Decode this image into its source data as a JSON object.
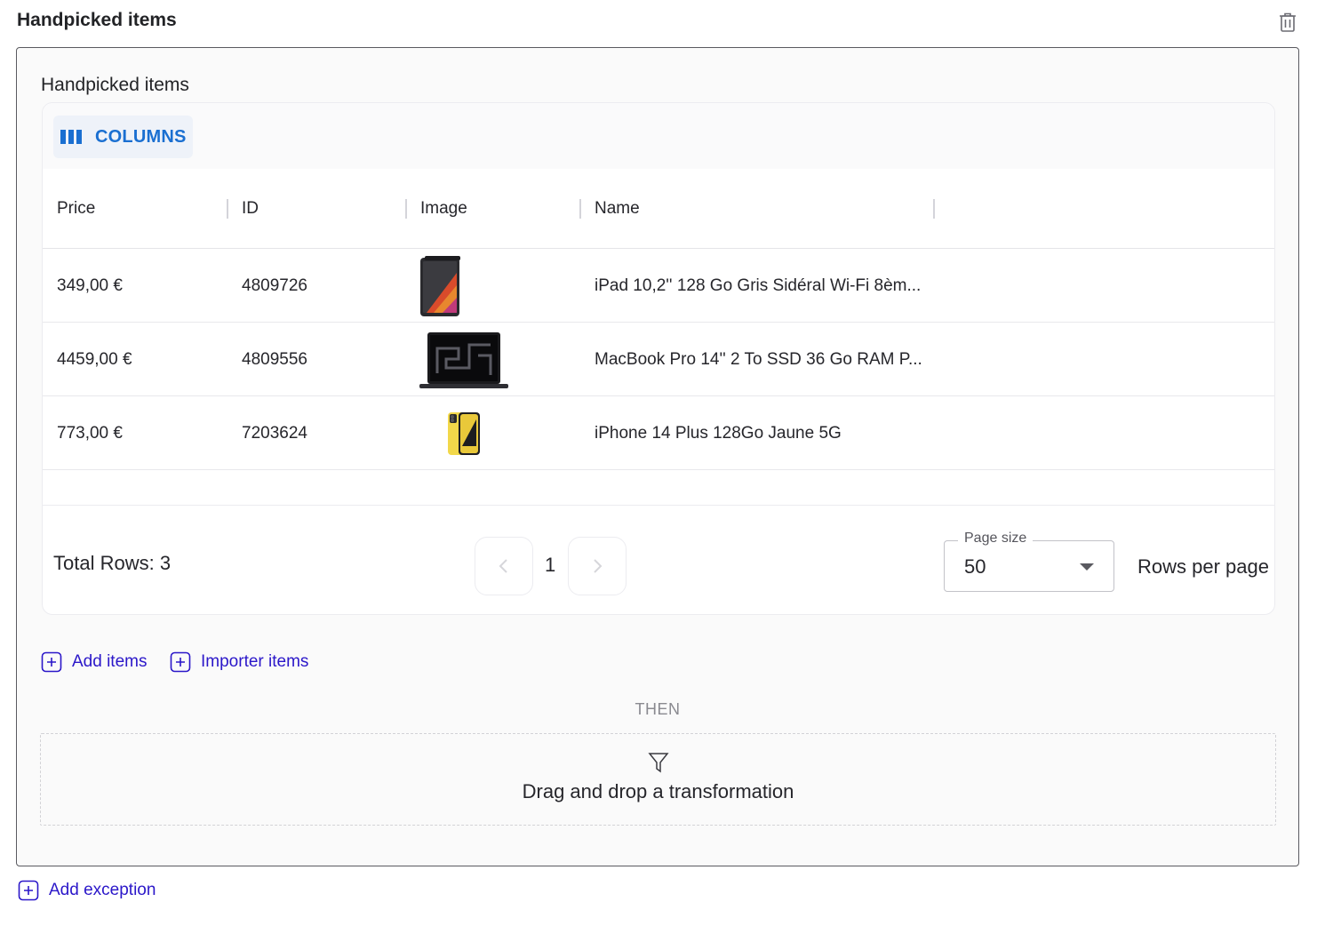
{
  "header": {
    "title": "Handpicked items",
    "delete_icon": "trash-icon"
  },
  "panel": {
    "title": "Handpicked items"
  },
  "toolbar": {
    "columns_label": "COLUMNS",
    "columns_icon": "columns-icon",
    "accent_color": "#1a6fd1"
  },
  "table": {
    "headers": [
      "Price",
      "ID",
      "Image",
      "Name"
    ],
    "rows": [
      {
        "price": "349,00 €",
        "id": "4809726",
        "image": "ipad-thumbnail",
        "name": "iPad 10,2'' 128 Go Gris Sidéral Wi-Fi 8èm..."
      },
      {
        "price": "4459,00 €",
        "id": "4809556",
        "image": "macbook-thumbnail",
        "name": "MacBook Pro 14'' 2 To SSD 36 Go RAM P..."
      },
      {
        "price": "773,00 €",
        "id": "7203624",
        "image": "iphone-thumbnail",
        "name": "iPhone 14 Plus 128Go Jaune 5G"
      }
    ]
  },
  "footer": {
    "total_rows": "Total Rows: 3",
    "current_page": "1",
    "page_size_label": "Page size",
    "page_size_value": "50",
    "rows_per_page": "Rows per page"
  },
  "actions": {
    "add_items": "Add items",
    "import_items": "Importer items",
    "link_color": "#2b17c9"
  },
  "then_label": "THEN",
  "dropzone": {
    "icon": "filter-icon",
    "text": "Drag and drop a transformation"
  },
  "add_exception": "Add exception"
}
